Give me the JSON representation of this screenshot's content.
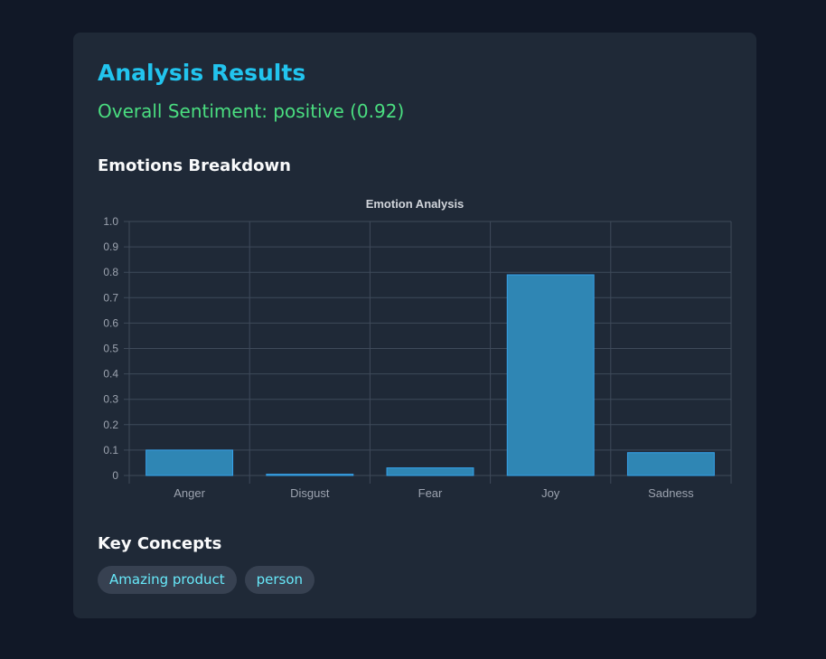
{
  "card": {
    "title": "Analysis Results",
    "sentiment_text": "Overall Sentiment: positive (0.92)",
    "emotions_heading": "Emotions Breakdown",
    "concepts_heading": "Key Concepts",
    "concepts": [
      "Amazing product",
      "person"
    ]
  },
  "colors": {
    "page_background": "#111827",
    "card_background": "#1f2937",
    "title": "#22c4ee",
    "sentiment_positive": "#4ade80",
    "bar_fill": "#2f86b4",
    "bar_border": "#36a2eb",
    "tag_text": "#67e8f9",
    "tag_background": "#374151"
  },
  "chart_data": {
    "type": "bar",
    "title": "Emotion Analysis",
    "categories": [
      "Anger",
      "Disgust",
      "Fear",
      "Joy",
      "Sadness"
    ],
    "values": [
      0.1,
      0.005,
      0.03,
      0.79,
      0.09
    ],
    "ylim": [
      0,
      1.0
    ],
    "yticks": [
      "0",
      "0.1",
      "0.2",
      "0.3",
      "0.4",
      "0.5",
      "0.6",
      "0.7",
      "0.8",
      "0.9",
      "1.0"
    ],
    "grid": true,
    "legend": "none"
  }
}
